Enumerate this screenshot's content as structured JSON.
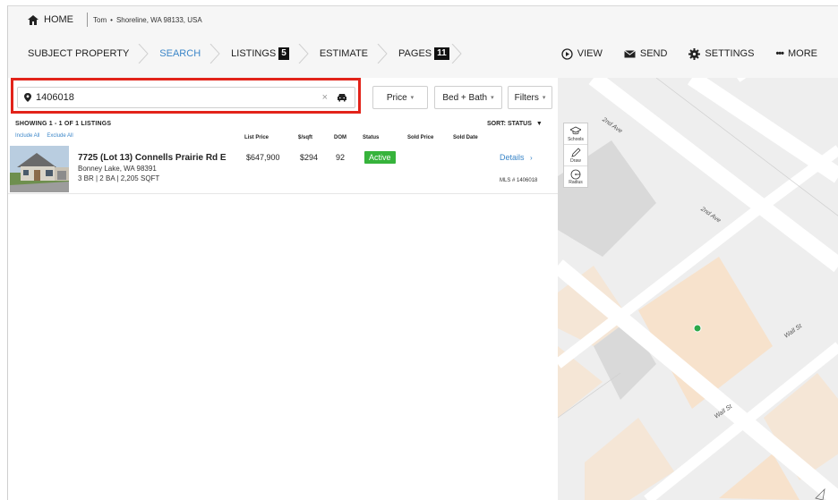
{
  "topbar": {
    "home_label": "HOME",
    "user": "Tom",
    "location": "Shoreline, WA 98133, USA"
  },
  "nav": {
    "items": [
      {
        "label": "SUBJECT PROPERTY"
      },
      {
        "label": "SEARCH"
      },
      {
        "label": "LISTINGS",
        "badge": "5"
      },
      {
        "label": "ESTIMATE"
      },
      {
        "label": "PAGES",
        "badge": "11"
      }
    ],
    "right": {
      "view": "VIEW",
      "send": "SEND",
      "settings": "SETTINGS",
      "more": "MORE"
    }
  },
  "search": {
    "value": "1406018",
    "clear": "×"
  },
  "filters": {
    "price": "Price",
    "bedbath": "Bed + Bath",
    "filters": "Filters"
  },
  "results": {
    "showing": "SHOWING 1 - 1 OF 1 LISTINGS",
    "sort": "SORT: STATUS",
    "include_all": "Include All",
    "exclude_all": "Exclude All",
    "columns": {
      "list_price": "List Price",
      "sqft": "$/sqft",
      "dom": "DOM",
      "status": "Status",
      "sold_price": "Sold Price",
      "sold_date": "Sold Date"
    }
  },
  "listing": {
    "title": "7725 (Lot 13) Connells Prairie Rd E",
    "city": "Bonney Lake, WA 98391",
    "beds": "3 BR | 2 BA | 2,205 SQFT",
    "list_price": "$647,900",
    "price_sqft": "$294",
    "dom": "92",
    "status": "Active",
    "details": "Details",
    "mls": "MLS # 1406018"
  },
  "map": {
    "tools": {
      "schools": "Schools",
      "draw": "Draw",
      "radius": "Radius"
    },
    "streets": {
      "a": "2nd Ave",
      "b": "2nd Ave",
      "c": "Wall St",
      "d": "Wall St",
      "e": "St"
    }
  },
  "colors": {
    "accent": "#3b86c8",
    "highlight": "#e2231a",
    "active": "#36b33b"
  }
}
